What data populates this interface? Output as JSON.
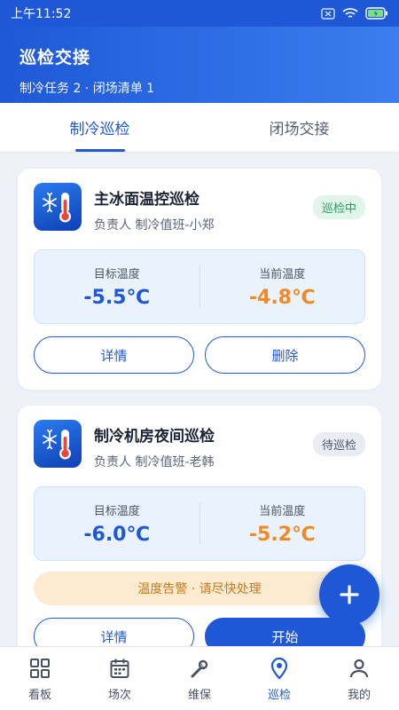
{
  "status_bar": {
    "time": "上午11:52"
  },
  "header": {
    "title": "巡检交接",
    "subtitle": "制冷任务 2 · 闭场清单 1"
  },
  "tabs": [
    {
      "label": "制冷巡检",
      "active": true
    },
    {
      "label": "闭场交接",
      "active": false
    }
  ],
  "cards": [
    {
      "title": "主冰面温控巡检",
      "owner": "负责人 制冷值班-小郑",
      "status": "巡检中",
      "target_label": "目标温度",
      "target_value": "-5.5℃",
      "current_label": "当前温度",
      "current_value": "-4.8℃",
      "btn_left": "详情",
      "btn_right": "删除"
    },
    {
      "title": "制冷机房夜间巡检",
      "owner": "负责人 制冷值班-老韩",
      "status": "待巡检",
      "target_label": "目标温度",
      "target_value": "-6.0℃",
      "current_label": "当前温度",
      "current_value": "-5.2℃",
      "alert": "温度告警 · 请尽快处理",
      "btn_left": "详情",
      "btn_right": "开始"
    }
  ],
  "fab_icon": "plus-icon",
  "nav": [
    {
      "label": "看板",
      "icon": "grid-icon",
      "active": false
    },
    {
      "label": "场次",
      "icon": "calendar-icon",
      "active": false
    },
    {
      "label": "维保",
      "icon": "wrench-icon",
      "active": false
    },
    {
      "label": "巡检",
      "icon": "location-icon",
      "active": true
    },
    {
      "label": "我的",
      "icon": "user-icon",
      "active": false
    }
  ],
  "colors": {
    "primary": "#1f58d6",
    "orange": "#f08a24",
    "green_badge": "#2f9a5e"
  }
}
